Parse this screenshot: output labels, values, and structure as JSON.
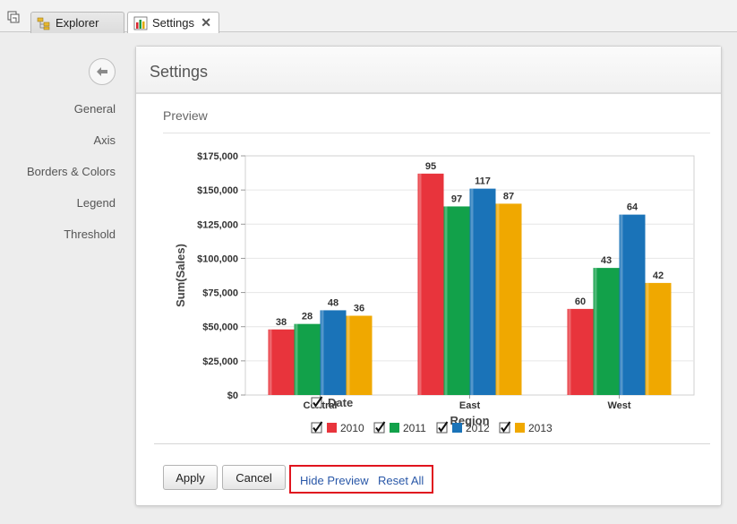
{
  "tabs": [
    {
      "label": "Explorer",
      "icon": "explorer-icon"
    },
    {
      "label": "Settings",
      "icon": "chart-icon",
      "close": "✕"
    }
  ],
  "nav": {
    "items": [
      {
        "label": "General"
      },
      {
        "label": "Axis"
      },
      {
        "label": "Borders & Colors"
      },
      {
        "label": "Legend"
      },
      {
        "label": "Threshold"
      }
    ]
  },
  "panel": {
    "title": "Settings",
    "preview_label": "Preview"
  },
  "buttons": {
    "apply": "Apply",
    "cancel": "Cancel",
    "hide_preview": "Hide Preview",
    "reset_all": "Reset All"
  },
  "colors": {
    "2010": "#e8343c",
    "2011": "#12a14a",
    "2012": "#1a73b8",
    "2013": "#f0a800",
    "highlight_box": "#e0141e"
  },
  "chart_data": {
    "type": "bar",
    "xlabel": "Region",
    "ylabel": "Sum(Sales)",
    "categories": [
      "Central",
      "East",
      "West"
    ],
    "ylim": [
      0,
      175000
    ],
    "yticks": [
      "$0",
      "$25,000",
      "$50,000",
      "$75,000",
      "$100,000",
      "$125,000",
      "$150,000",
      "$175,000"
    ],
    "grid": true,
    "legend_title": "Date",
    "legend_placement": "bottom",
    "series": [
      {
        "name": "2010",
        "values": [
          48000,
          162000,
          63000
        ],
        "labels": [
          "38",
          "95",
          "60"
        ]
      },
      {
        "name": "2011",
        "values": [
          52000,
          138000,
          93000
        ],
        "labels": [
          "28",
          "97",
          "43"
        ]
      },
      {
        "name": "2012",
        "values": [
          62000,
          151000,
          132000
        ],
        "labels": [
          "48",
          "117",
          "64"
        ]
      },
      {
        "name": "2013",
        "values": [
          58000,
          140000,
          82000
        ],
        "labels": [
          "36",
          "87",
          "42"
        ]
      }
    ]
  }
}
